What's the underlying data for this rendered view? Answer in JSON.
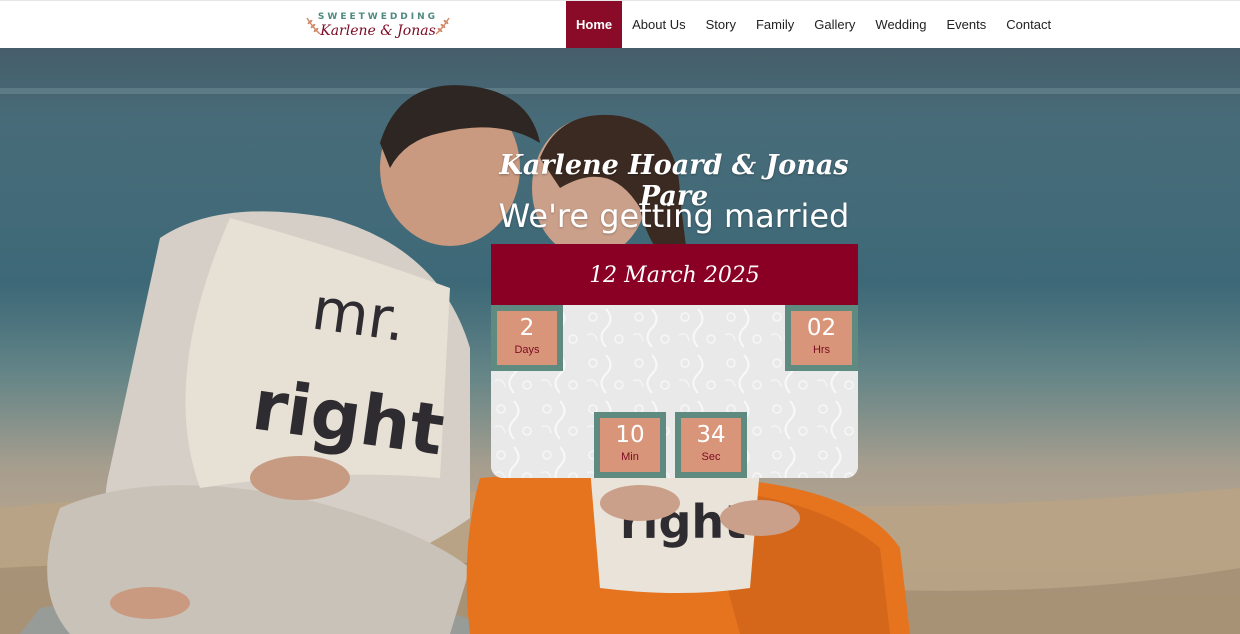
{
  "brand": {
    "top_text": "SWEETWEDDING",
    "names": "Karlene & Jonas"
  },
  "nav": {
    "items": [
      {
        "label": "Home",
        "active": true
      },
      {
        "label": "About Us"
      },
      {
        "label": "Story"
      },
      {
        "label": "Family"
      },
      {
        "label": "Gallery"
      },
      {
        "label": "Wedding"
      },
      {
        "label": "Events"
      },
      {
        "label": "Contact"
      }
    ]
  },
  "hero": {
    "couple": "Karlene Hoard & Jonas Pare",
    "tagline": "We're getting married",
    "date": "12 March 2025",
    "pillow_text_1": "mr. right",
    "pillow_text_2": "right"
  },
  "countdown": {
    "days": {
      "value": "2",
      "label": "Days"
    },
    "hours": {
      "value": "02",
      "label": "Hrs"
    },
    "minutes": {
      "value": "10",
      "label": "Min"
    },
    "seconds": {
      "value": "34",
      "label": "Sec"
    }
  },
  "colors": {
    "accent": "#8a0024",
    "tile_border": "#5f8a80",
    "tile_fill": "#d99579",
    "label": "#7c0b24"
  }
}
